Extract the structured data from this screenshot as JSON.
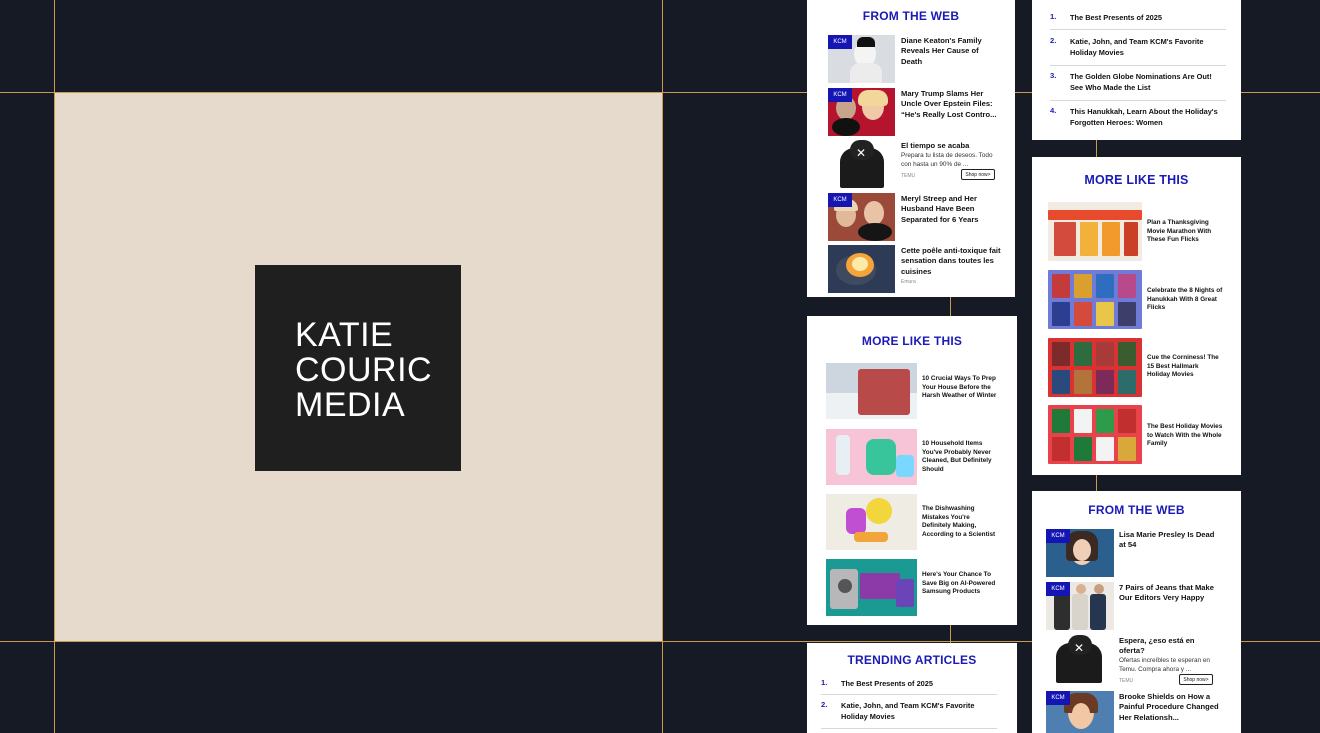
{
  "brand": {
    "logo_text": "KATIE\nCOURIC\nMEDIA"
  },
  "colors": {
    "background": "#161a24",
    "grid_line": "#c99a4e",
    "panel": "#e6dacd",
    "logo_box": "#1f1f1f",
    "accent": "#1a1ab6"
  },
  "left_column": {
    "from_web": {
      "heading": "FROM THE WEB",
      "items": [
        {
          "badge": "KCM",
          "title": "Diane Keaton's Family Reveals Her Cause of Death"
        },
        {
          "badge": "KCM",
          "title": "Mary Trump Slams Her Uncle Over Epstein Files: “He's Really Lost Contro..."
        },
        {
          "badge": "",
          "title": "El tiempo se acaba",
          "desc": "Prepara tu lista de deseos. Todo con hasta un 90% de ...",
          "source": "TEMU",
          "cta": "Shop now>"
        },
        {
          "badge": "KCM",
          "title": "Meryl Streep and Her Husband Have Been Separated for 6 Years"
        },
        {
          "badge": "",
          "title": "Cette poêle anti-toxique fait sensation dans toutes les cuisines",
          "source": "Emura"
        }
      ]
    },
    "more_like_this": {
      "heading": "MORE LIKE THIS",
      "items": [
        {
          "title": "10 Crucial Ways To Prep Your House Before the Harsh Weather of Winter"
        },
        {
          "title": "10 Household Items You've Probably Never Cleaned, But Definitely Should"
        },
        {
          "title": "The Dishwashing Mistakes You're Definitely Making, According to a Scientist"
        },
        {
          "title": "Here's Your Chance To Save Big on AI-Powered Samsung Products"
        }
      ]
    },
    "trending": {
      "heading": "TRENDING ARTICLES",
      "items": [
        {
          "num": "1.",
          "title": "The Best Presents of 2025"
        },
        {
          "num": "2.",
          "title": "Katie, John, and Team KCM's Favorite Holiday Movies"
        }
      ]
    }
  },
  "right_column": {
    "trending": {
      "items": [
        {
          "num": "1.",
          "title": "The Best Presents of 2025"
        },
        {
          "num": "2.",
          "title": "Katie, John, and Team KCM's Favorite Holiday Movies"
        },
        {
          "num": "3.",
          "title": "The Golden Globe Nominations Are Out! See Who Made the List"
        },
        {
          "num": "4.",
          "title": "This Hanukkah, Learn About the Holiday's Forgotten Heroes: Women"
        }
      ]
    },
    "more_like_this": {
      "heading": "MORE LIKE THIS",
      "items": [
        {
          "title": "Plan a Thanksgiving Movie Marathon With These Fun Flicks"
        },
        {
          "title": "Celebrate the 8 Nights of Hanukkah With 8 Great Flicks"
        },
        {
          "title": "Cue the Corniness! The 15 Best Hallmark Holiday Movies"
        },
        {
          "title": "The Best Holiday Movies to Watch With the Whole Family"
        }
      ]
    },
    "from_web": {
      "heading": "FROM THE WEB",
      "items": [
        {
          "badge": "KCM",
          "title": "Lisa Marie Presley Is Dead at 54"
        },
        {
          "badge": "KCM",
          "title": "7 Pairs of Jeans that Make Our Editors Very Happy"
        },
        {
          "badge": "",
          "title": "Espera, ¿eso está en oferta?",
          "desc": "Ofertas increíbles te esperan en Temu. Compra ahora y ...",
          "source": "TEMU",
          "cta": "Shop now>"
        },
        {
          "badge": "KCM",
          "title": "Brooke Shields on How a Painful Procedure Changed Her Relationsh..."
        }
      ]
    }
  }
}
